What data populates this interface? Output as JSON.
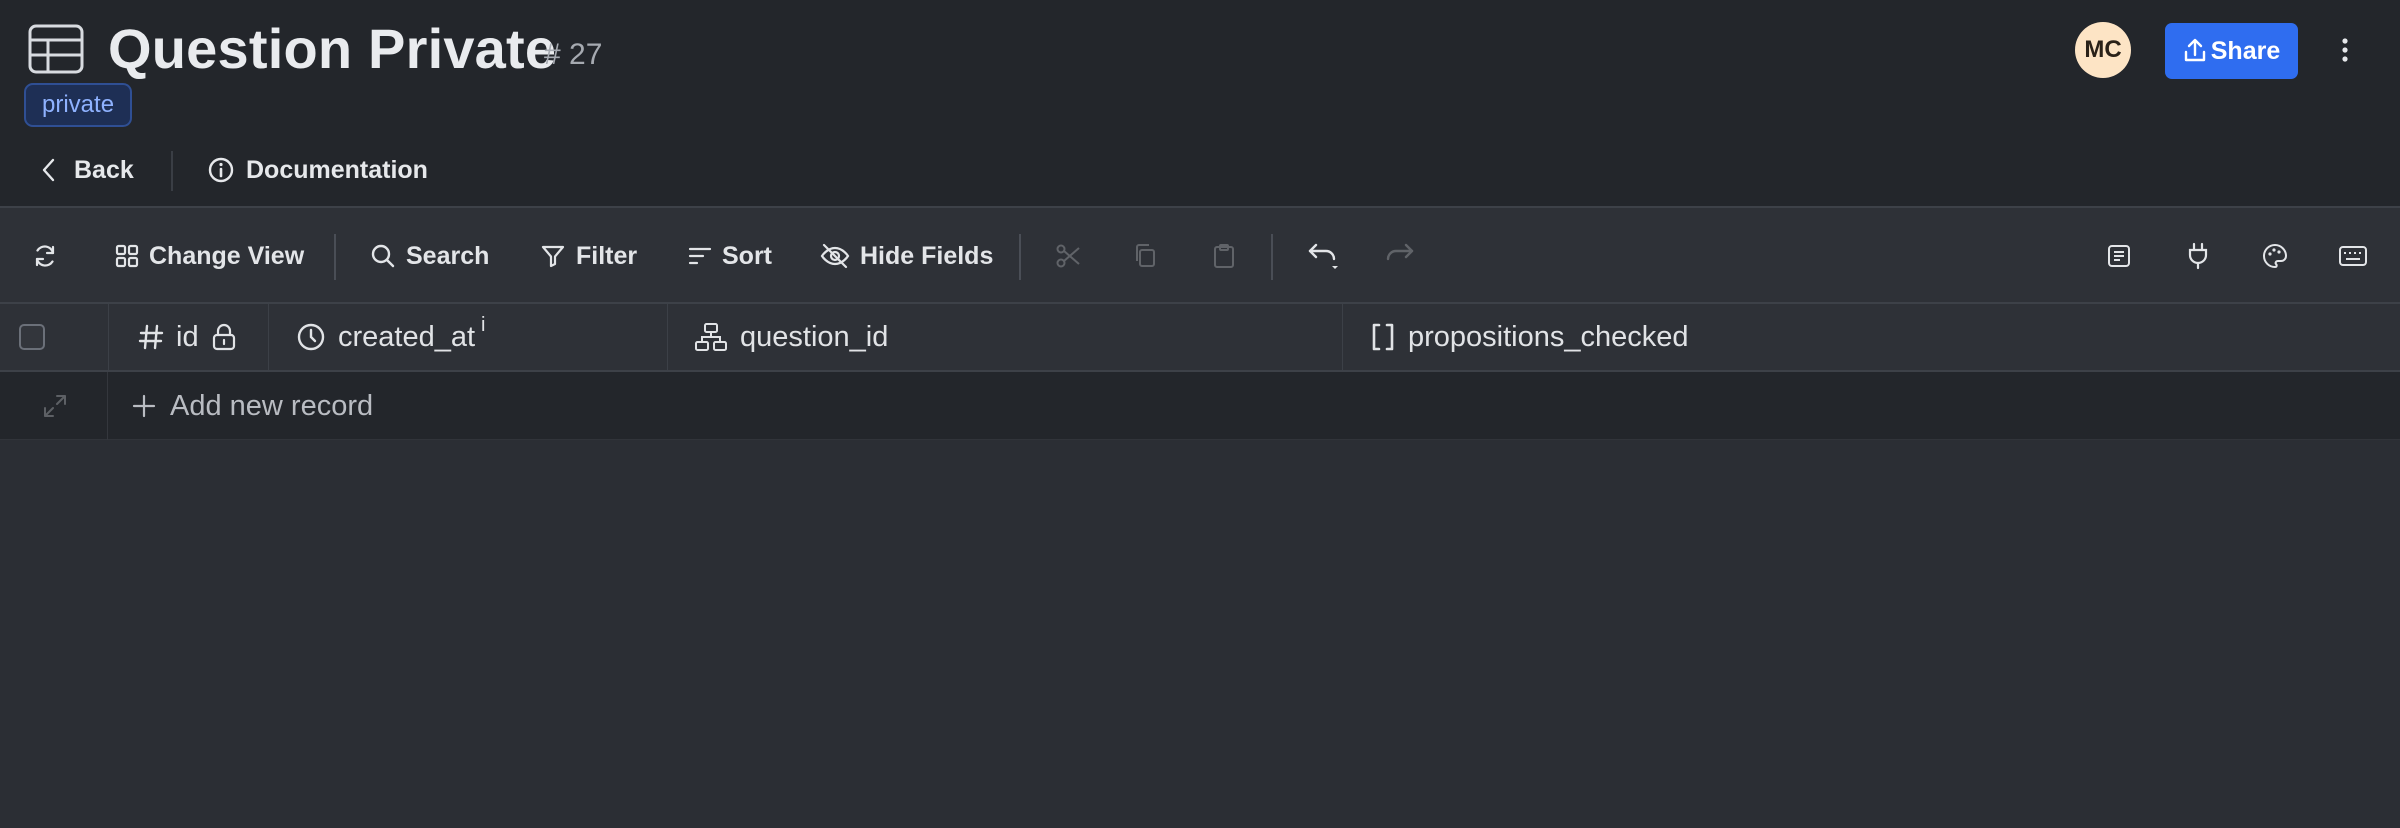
{
  "header": {
    "title": "Question Private",
    "record_id": "# 27",
    "tag": "private",
    "avatar_initials": "MC",
    "share_label": "Share",
    "back_label": "Back",
    "docs_label": "Documentation",
    "icons": [
      "table-icon",
      "upload-icon",
      "more-vertical-icon",
      "chevron-left-icon",
      "info-icon"
    ]
  },
  "toolbar": {
    "change_view": "Change View",
    "search": "Search",
    "filter": "Filter",
    "sort": "Sort",
    "hide_fields": "Hide Fields",
    "icons": [
      "refresh-icon",
      "grid-icon",
      "search-icon",
      "filter-icon",
      "sort-icon",
      "eye-off-icon",
      "scissors-icon",
      "copy-icon",
      "clipboard-icon",
      "undo-icon",
      "redo-icon",
      "form-icon",
      "plug-icon",
      "palette-icon",
      "keyboard-icon"
    ]
  },
  "grid": {
    "columns": [
      {
        "label": "id",
        "icon": "hash-icon",
        "locked": true
      },
      {
        "label": "created_at",
        "icon": "clock-icon",
        "superscript": "i"
      },
      {
        "label": "question_id",
        "icon": "relation-icon"
      },
      {
        "label": "propositions_checked",
        "icon": "brackets-icon"
      }
    ],
    "add_record_label": "Add new record"
  },
  "colors": {
    "background": "#2b2e34",
    "header_bg": "#23262b",
    "accent": "#2f6df0",
    "tag_text": "#8fb2ff",
    "avatar_bg": "#fde4c5"
  }
}
